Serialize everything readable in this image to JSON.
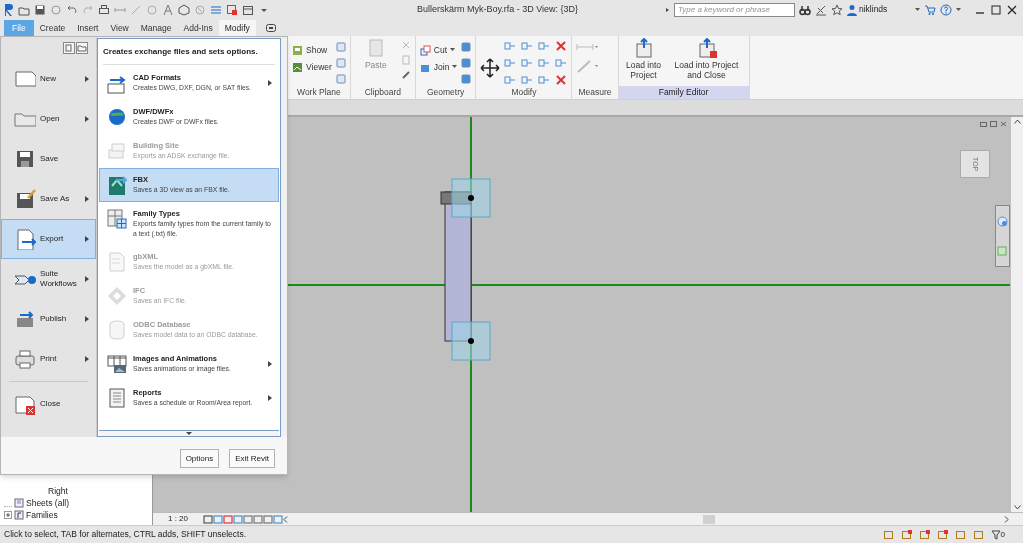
{
  "title_bar": {
    "title": "Bullerskärm Myk-Boy.rfa - 3D View: {3D}",
    "search_placeholder": "Type a keyword or phrase",
    "user": "niklinds"
  },
  "ribbon_tabs": [
    {
      "label": "File",
      "kind": "app_menu",
      "selected": true
    },
    {
      "label": "Create",
      "kind": "tab",
      "selected": false
    },
    {
      "label": "Insert",
      "kind": "tab",
      "selected": false
    },
    {
      "label": "View",
      "kind": "tab",
      "selected": false
    },
    {
      "label": "Manage",
      "kind": "tab",
      "selected": false
    },
    {
      "label": "Add-Ins",
      "kind": "tab",
      "selected": false
    },
    {
      "label": "Modify",
      "kind": "tab",
      "selected": true
    }
  ],
  "ribbon_panels": [
    {
      "label": "Work Plane",
      "kind": "small",
      "contextual": false,
      "buttons": [
        {
          "label": "Show",
          "disabled": false
        },
        {
          "label": "Viewer",
          "disabled": false
        }
      ]
    },
    {
      "label": "Clipboard",
      "kind": "large",
      "contextual": false,
      "buttons": [
        {
          "label": "Paste",
          "disabled": true
        }
      ]
    },
    {
      "label": "Geometry",
      "kind": "small",
      "contextual": false,
      "buttons": [
        {
          "label": "Cut",
          "disabled": false
        },
        {
          "label": "Join",
          "disabled": false
        }
      ]
    },
    {
      "label": "Modify",
      "kind": "icons",
      "contextual": false
    },
    {
      "label": "Measure",
      "kind": "icons",
      "contextual": false
    },
    {
      "label": "Family Editor",
      "kind": "large",
      "contextual": true,
      "buttons": [
        {
          "label": "Load into Project",
          "disabled": false
        },
        {
          "label": "Load into Project and Close",
          "disabled": false
        }
      ]
    }
  ],
  "app_menu": {
    "commands": [
      {
        "label": "New",
        "submenu": true,
        "selected": false
      },
      {
        "label": "Open",
        "submenu": true,
        "selected": false
      },
      {
        "label": "Save",
        "submenu": false,
        "selected": false
      },
      {
        "label": "Save As",
        "submenu": true,
        "selected": false
      },
      {
        "label": "Export",
        "submenu": true,
        "selected": true
      },
      {
        "label": "Suite Workflows",
        "submenu": true,
        "selected": false
      },
      {
        "label": "Publish",
        "submenu": true,
        "selected": false
      },
      {
        "label": "Print",
        "submenu": true,
        "selected": false
      },
      {
        "label": "Close",
        "submenu": false,
        "selected": false
      }
    ],
    "panel": {
      "heading": "Creates exchange files and sets options.",
      "items": [
        {
          "title": "CAD Formats",
          "description": "Creates DWG, DXF, DGN, or SAT files.",
          "disabled": false,
          "selected": false,
          "submenu": true
        },
        {
          "title": "DWF/DWFx",
          "description": "Creates DWF or DWFx files.",
          "disabled": false,
          "selected": false,
          "submenu": false
        },
        {
          "title": "Building Site",
          "description": "Exports an ADSK exchange file.",
          "disabled": true,
          "selected": false,
          "submenu": false
        },
        {
          "title": "FBX",
          "description": "Saves a 3D view as an FBX file.",
          "disabled": false,
          "selected": true,
          "submenu": false
        },
        {
          "title": "Family Types",
          "description": "Exports family types from the current family to a text (.txt) file.",
          "disabled": false,
          "selected": false,
          "submenu": false
        },
        {
          "title": "gbXML",
          "description": "Saves the model as a gbXML file.",
          "disabled": true,
          "selected": false,
          "submenu": false
        },
        {
          "title": "IFC",
          "description": "Saves an IFC file.",
          "disabled": true,
          "selected": false,
          "submenu": false
        },
        {
          "title": "ODBC Database",
          "description": "Saves model data to an ODBC database.",
          "disabled": true,
          "selected": false,
          "submenu": false
        },
        {
          "title": "Images and Animations",
          "description": "Saves animations or image files.",
          "disabled": false,
          "selected": false,
          "submenu": true
        },
        {
          "title": "Reports",
          "description": "Saves a schedule or Room/Area report.",
          "disabled": false,
          "selected": false,
          "submenu": true
        }
      ]
    },
    "buttons": [
      "Options",
      "Exit Revit"
    ]
  },
  "project_browser": {
    "items": [
      {
        "label": "Right",
        "kind": "view"
      },
      {
        "label": "Sheets (all)",
        "kind": "sheets"
      },
      {
        "label": "Families",
        "kind": "families",
        "expanded": false
      }
    ]
  },
  "view": {
    "view_cube": "TOP",
    "scale": "1 : 20"
  },
  "status_bar": {
    "message": "Click to select, TAB for alternates, CTRL adds, SHIFT unselects.",
    "filter_count": "0"
  }
}
